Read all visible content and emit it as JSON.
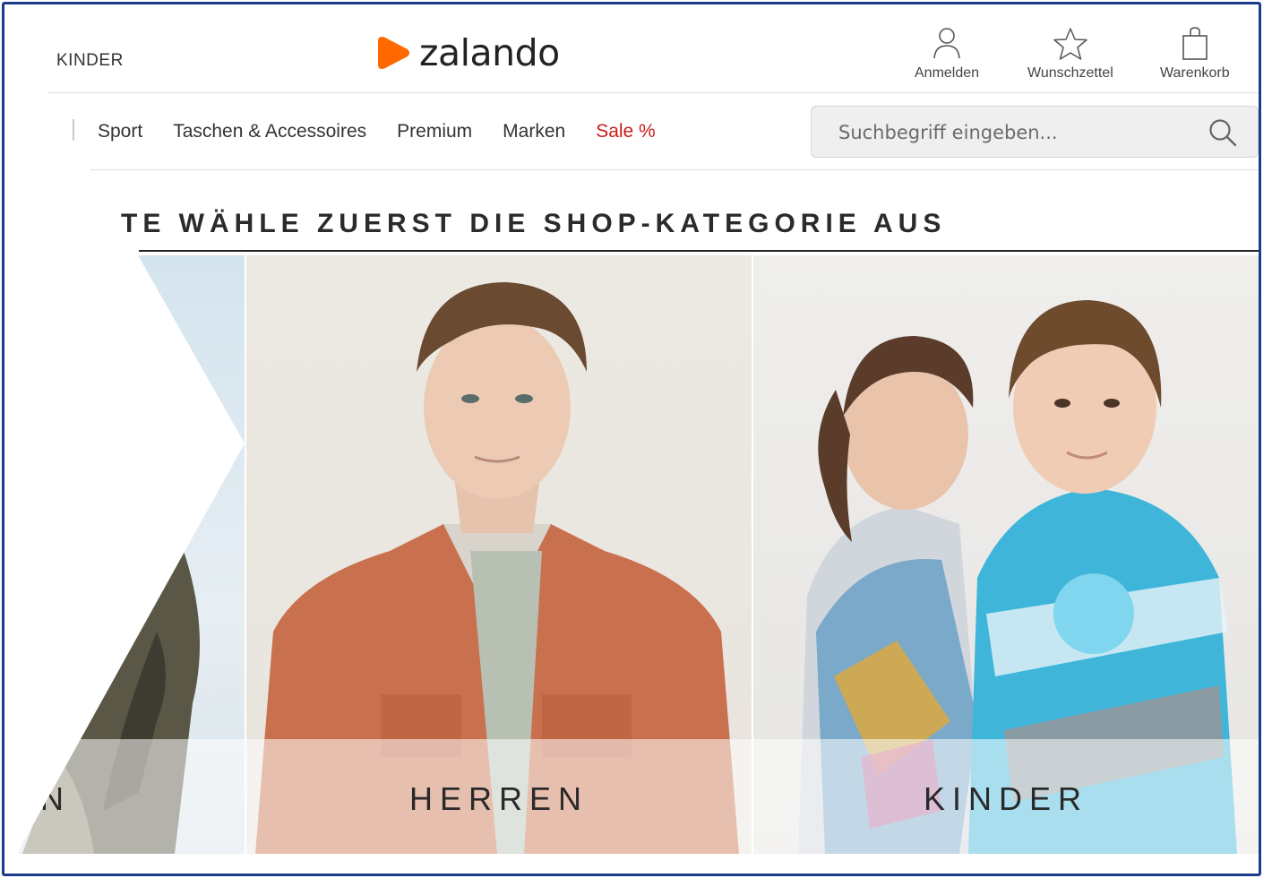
{
  "header": {
    "gender_link": "KINDER",
    "logo_text": "zalando",
    "brand_color": "#ff6900",
    "login_label": "Anmelden",
    "wishlist_label": "Wunschzettel",
    "cart_label": "Warenkorb"
  },
  "nav": {
    "items": [
      {
        "label": "Sport",
        "icon": ""
      },
      {
        "label": "Taschen & Accessoires",
        "icon": ""
      },
      {
        "label": "Premium",
        "icon": ""
      },
      {
        "label": "Marken",
        "icon": ""
      },
      {
        "label": "Sale %",
        "color": "#cc1a1a"
      }
    ]
  },
  "search": {
    "placeholder": "Suchbegriff eingeben...",
    "icon": "search-icon"
  },
  "main": {
    "headline": "TE WÄHLE ZUERST DIE SHOP-KATEGORIE AUS",
    "categories": [
      {
        "label": "N"
      },
      {
        "label": "HERREN"
      },
      {
        "label": "KINDER"
      }
    ]
  },
  "frame_color": "#1e3c8c"
}
